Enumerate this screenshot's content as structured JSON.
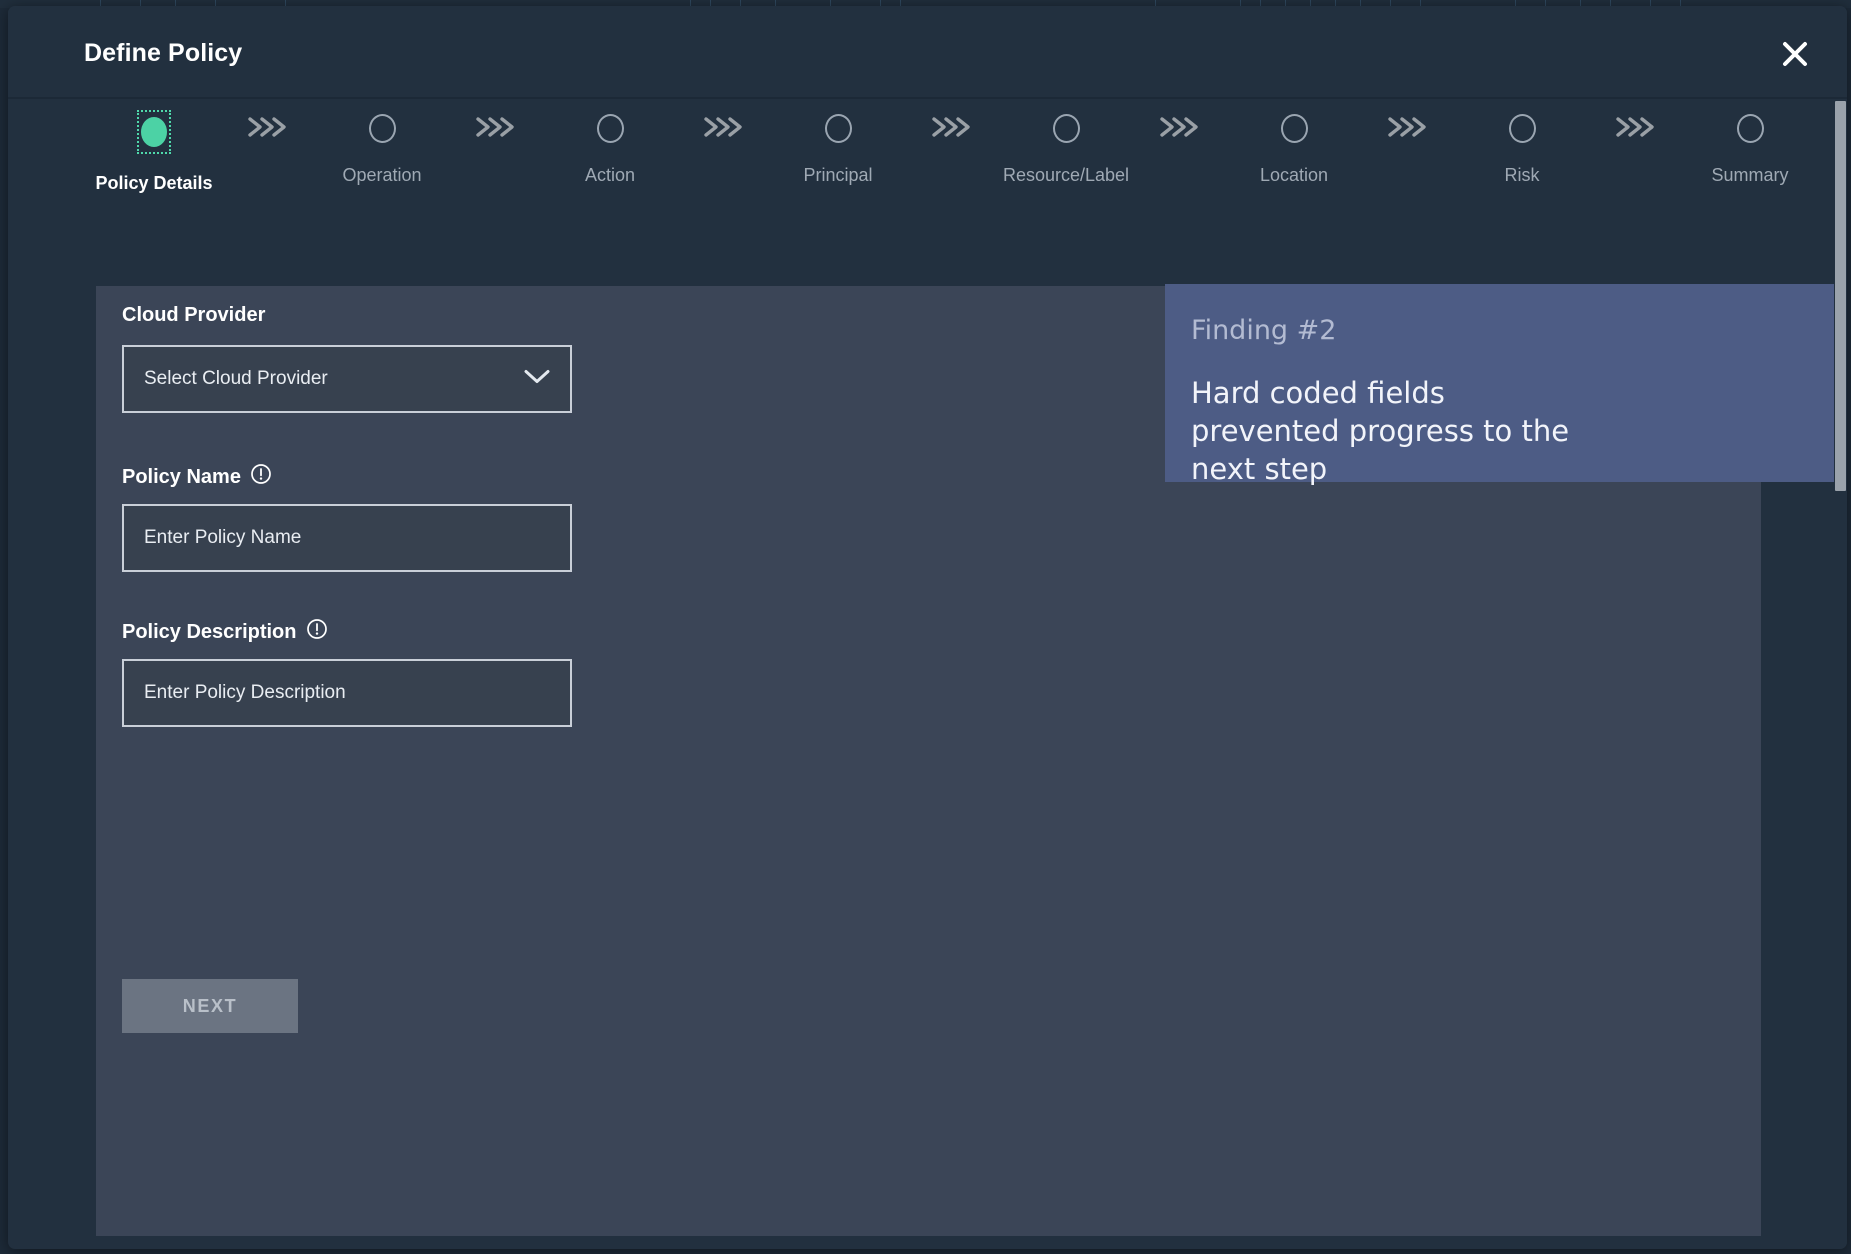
{
  "modal": {
    "title": "Define Policy",
    "close_icon": "close-icon"
  },
  "stepper": {
    "steps": [
      {
        "label": "Policy Details",
        "state": "active"
      },
      {
        "label": "Operation",
        "state": "inactive"
      },
      {
        "label": "Action",
        "state": "inactive"
      },
      {
        "label": "Principal",
        "state": "inactive"
      },
      {
        "label": "Resource/Label",
        "state": "inactive"
      },
      {
        "label": "Location",
        "state": "inactive"
      },
      {
        "label": "Risk",
        "state": "inactive"
      },
      {
        "label": "Summary",
        "state": "inactive"
      }
    ],
    "separator_icon": "chevrons-right-icon"
  },
  "form": {
    "cloud_provider": {
      "label": "Cloud Provider",
      "value": "Select Cloud Provider",
      "caret_icon": "chevron-down-icon"
    },
    "policy_name": {
      "label": "Policy Name",
      "required_icon": "exclamation-circle-icon",
      "placeholder": "Enter Policy Name",
      "value": ""
    },
    "policy_description": {
      "label": "Policy Description",
      "required_icon": "exclamation-circle-icon",
      "placeholder": "Enter Policy Description",
      "value": ""
    }
  },
  "actions": {
    "next_label": "NEXT",
    "next_disabled": true
  },
  "annotation": {
    "title": "Finding #2",
    "body": "Hard coded fields prevented progress to the next step"
  },
  "colors": {
    "modal_bg": "#22303f",
    "panel_bg": "#3b4557",
    "accent_green": "#4cd2a5",
    "annotation_bg": "#4d5c85",
    "disabled_button": "#6b7482",
    "muted_text": "#9fa9b4"
  }
}
